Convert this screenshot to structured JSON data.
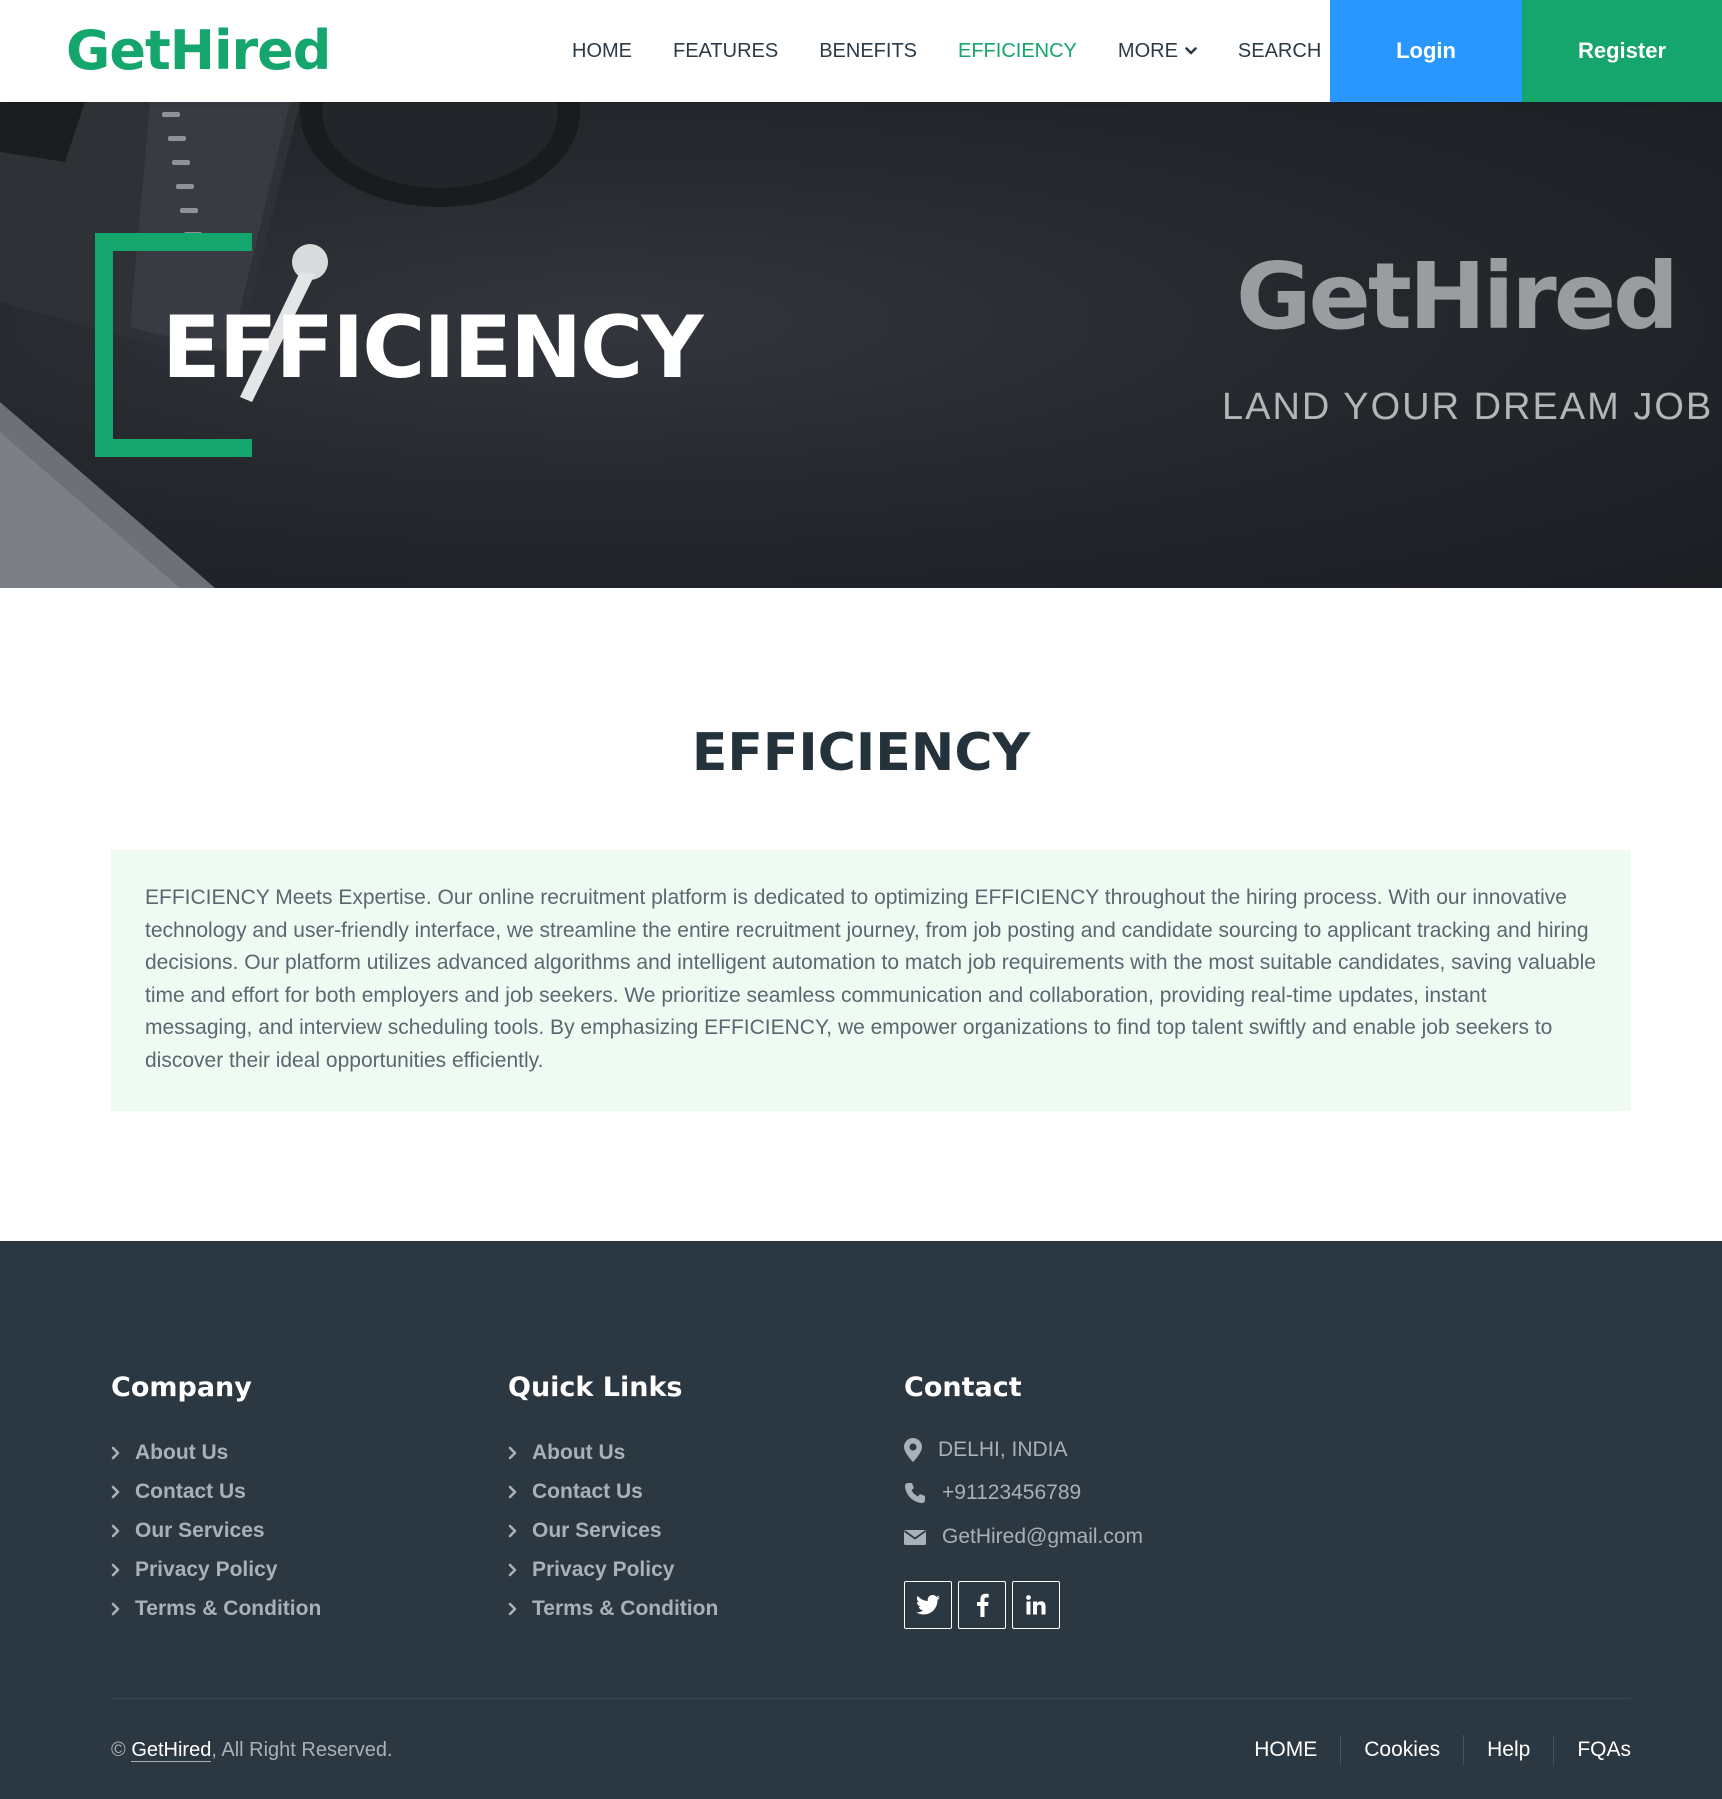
{
  "brand": {
    "name": "GetHired",
    "primary_color": "#14a66d",
    "login_color": "#2997ff"
  },
  "nav": {
    "items": [
      {
        "label": "HOME"
      },
      {
        "label": "FEATURES"
      },
      {
        "label": "BENEFITS"
      },
      {
        "label": "EFFICIENCY",
        "active": true
      },
      {
        "label": "MORE",
        "icon": "chevron-down-icon"
      },
      {
        "label": "SEARCH"
      }
    ],
    "login_label": "Login",
    "register_label": "Register"
  },
  "hero": {
    "title": "EFFICIENCY",
    "brand": "GetHired",
    "tagline": "LAND YOUR DREAM JOB"
  },
  "main": {
    "section_title": "EFFICIENCY",
    "body": "EFFICIENCY Meets Expertise. Our online recruitment platform is dedicated to optimizing EFFICIENCY throughout the hiring process. With our innovative technology and user-friendly interface, we streamline the entire recruitment journey, from job posting and candidate sourcing to applicant tracking and hiring decisions. Our platform utilizes advanced algorithms and intelligent automation to match job requirements with the most suitable candidates, saving valuable time and effort for both employers and job seekers. We prioritize seamless communication and collaboration, providing real-time updates, instant messaging, and interview scheduling tools. By emphasizing EFFICIENCY, we empower organizations to find top talent swiftly and enable job seekers to discover their ideal opportunities efficiently."
  },
  "footer": {
    "company": {
      "title": "Company",
      "links": [
        "About Us",
        "Contact Us",
        "Our Services",
        "Privacy Policy",
        "Terms & Condition"
      ]
    },
    "quick_links": {
      "title": "Quick Links",
      "links": [
        "About Us",
        "Contact Us",
        "Our Services",
        "Privacy Policy",
        "Terms & Condition"
      ]
    },
    "contact": {
      "title": "Contact",
      "location": "DELHI, INDIA",
      "phone": "+91123456789",
      "email": "GetHired@gmail.com",
      "social": [
        "twitter-icon",
        "facebook-icon",
        "linkedin-icon"
      ]
    },
    "copyright": {
      "prefix": "©",
      "brand": "GetHired",
      "suffix": ", All Right Reserved."
    },
    "bottom_links": [
      "HOME",
      "Cookies",
      "Help",
      "FQAs"
    ]
  }
}
